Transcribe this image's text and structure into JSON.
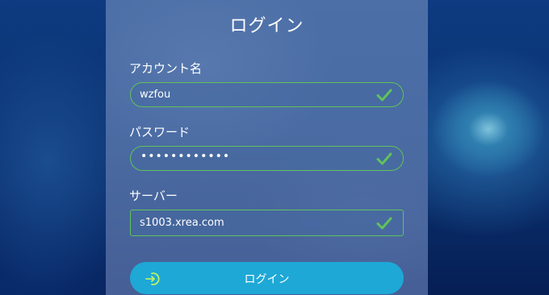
{
  "login": {
    "title": "ログイン",
    "account": {
      "label": "アカウント名",
      "value": "wzfou"
    },
    "password": {
      "label": "パスワード",
      "value": "••••••••••••"
    },
    "server": {
      "label": "サーバー",
      "value": "s1003.xrea.com"
    },
    "button_label": "ログイン"
  },
  "colors": {
    "valid": "#5fc35a",
    "button": "#1ea8d6",
    "panel": "#4a6ba3"
  },
  "icons": {
    "check": "check-icon",
    "login": "login-arrow-icon"
  }
}
